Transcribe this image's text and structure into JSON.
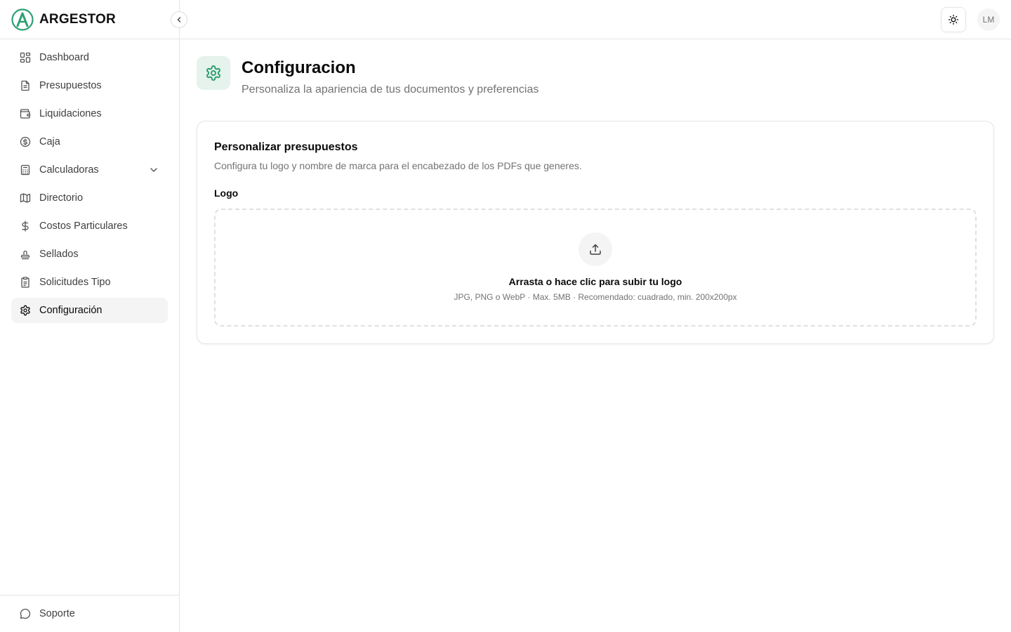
{
  "brand": {
    "name": "ARGESTOR",
    "accent": "#2e9f73"
  },
  "sidebar": {
    "items": [
      {
        "label": "Dashboard",
        "icon": "dashboard-icon"
      },
      {
        "label": "Presupuestos",
        "icon": "file-text-icon"
      },
      {
        "label": "Liquidaciones",
        "icon": "wallet-icon"
      },
      {
        "label": "Caja",
        "icon": "dollar-circle-icon"
      },
      {
        "label": "Calculadoras",
        "icon": "calculator-icon",
        "expandable": true
      },
      {
        "label": "Directorio",
        "icon": "map-icon"
      },
      {
        "label": "Costos Particulares",
        "icon": "dollar-sign-icon"
      },
      {
        "label": "Sellados",
        "icon": "stamp-icon"
      },
      {
        "label": "Solicitudes Tipo",
        "icon": "clipboard-icon"
      },
      {
        "label": "Configuración",
        "icon": "gear-icon",
        "active": true
      }
    ],
    "support_label": "Soporte"
  },
  "header": {
    "avatar_initials": "LM"
  },
  "page": {
    "title": "Configuracion",
    "subtitle": "Personaliza la apariencia de tus documentos y preferencias"
  },
  "card": {
    "title": "Personalizar presupuestos",
    "description": "Configura tu logo y nombre de marca para el encabezado de los PDFs que generes.",
    "logo_label": "Logo",
    "dropzone_title": "Arrasta o hace clic para subir tu logo",
    "dropzone_hint": "JPG, PNG o WebP · Max. 5MB · Recomendado: cuadrado, min. 200x200px"
  }
}
